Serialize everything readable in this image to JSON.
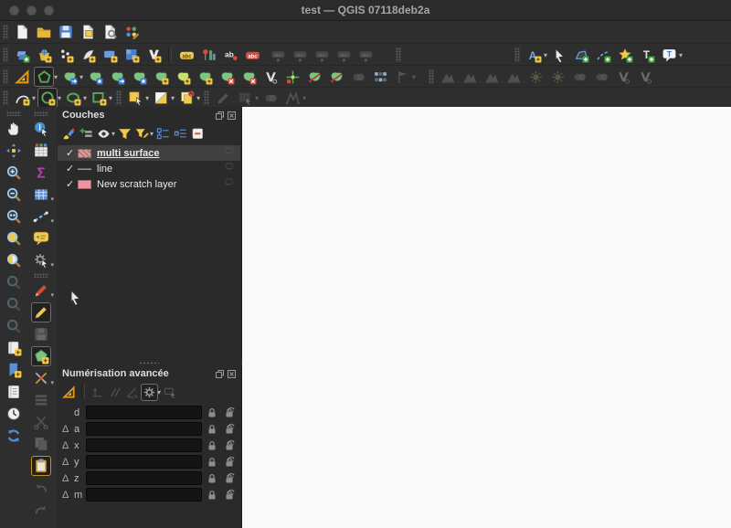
{
  "window": {
    "title": "test — QGIS 07118deb2a"
  },
  "colors": {
    "toolbar_bg": "#2e2e2e",
    "panel_bg": "#2a2a2a",
    "canvas_bg": "#fbfafa",
    "selection_bg": "#404040",
    "accent_blue": "#5b8fd6",
    "accent_yellow": "#f2c94c",
    "accent_green": "#7cc47f",
    "accent_red": "#d84b3a",
    "scratch_pink": "#ef93a1"
  },
  "toolbars": {
    "row1": [
      {
        "t": "h"
      },
      {
        "n": "new-project-icon",
        "k": "page"
      },
      {
        "n": "open-project-icon",
        "k": "folder"
      },
      {
        "n": "save-project-icon",
        "k": "floppy"
      },
      {
        "n": "new-print-layout-icon",
        "k": "layout"
      },
      {
        "n": "layout-manager-icon",
        "k": "wrenchdoc"
      },
      {
        "n": "style-manager-icon",
        "k": "styledots"
      }
    ],
    "row2": [
      {
        "t": "h"
      },
      {
        "n": "data-source-manager-icon",
        "k": "layersplus"
      },
      {
        "n": "new-geopackage-layer-icon",
        "k": "bucket"
      },
      {
        "n": "new-shapefile-layer-icon",
        "k": "dots3"
      },
      {
        "n": "new-spatialite-layer-icon",
        "k": "quill"
      },
      {
        "n": "new-temporary-scratch-layer-icon",
        "k": "bluerect"
      },
      {
        "n": "new-mesh-layer-icon",
        "k": "meshsq"
      },
      {
        "n": "new-virtual-layer-icon",
        "k": "vlayer"
      },
      {
        "t": "s"
      },
      {
        "n": "layer-labeling-icon",
        "k": "tag",
        "c": "#f2c94c"
      },
      {
        "n": "layer-diagram-icon",
        "k": "labelpin"
      },
      {
        "n": "labeling-options-icon",
        "k": "abdot"
      },
      {
        "n": "layer-labeling-rules-icon",
        "k": "tag",
        "c": "#d84b3a"
      },
      {
        "t": "sp",
        "w": 4
      },
      {
        "n": "pin-labels-icon",
        "k": "tagpin",
        "d": 1
      },
      {
        "n": "highlight-pinned-labels-icon",
        "k": "tagpin",
        "d": 1
      },
      {
        "n": "move-label-icon",
        "k": "tagpin",
        "d": 1
      },
      {
        "n": "rotate-label-icon",
        "k": "tagpin",
        "d": 1
      },
      {
        "n": "change-label-icon",
        "k": "tagpin",
        "d": 1
      },
      {
        "t": "sp",
        "w": 18
      },
      {
        "t": "h"
      },
      {
        "t": "sp",
        "w": 118
      },
      {
        "t": "h"
      },
      {
        "n": "annotation-layer-icon",
        "k": "astar",
        "dd": 1
      },
      {
        "n": "select-annotation-icon",
        "k": "cursor"
      },
      {
        "n": "polygon-annotation-icon",
        "k": "polyannot"
      },
      {
        "n": "line-annotation-icon",
        "k": "lineannot"
      },
      {
        "n": "marker-annotation-icon",
        "k": "starannot"
      },
      {
        "n": "text-annotation-icon",
        "k": "tannot"
      },
      {
        "n": "text-balloon-annotation-icon",
        "k": "balloon",
        "dd": 1
      }
    ],
    "row3": [
      {
        "t": "h"
      },
      {
        "n": "advanced-digitizing-icon",
        "k": "setsquare"
      },
      {
        "n": "digitize-with-shape-icon",
        "k": "pentagon",
        "a": 1,
        "dd": 1
      },
      {
        "n": "move-feature-icon",
        "k": "blob",
        "b": "arr",
        "bc": "#3d79d8",
        "dd": 1
      },
      {
        "n": "rotate-feature-icon",
        "k": "blob",
        "b": "dot",
        "bc": "#3d79d8"
      },
      {
        "n": "simplify-feature-icon",
        "k": "blob",
        "b": "arr",
        "bc": "#3d79d8"
      },
      {
        "n": "add-ring-icon",
        "k": "blob",
        "b": "dot",
        "bc": "#4d7fd0"
      },
      {
        "n": "add-part-icon",
        "k": "blob",
        "b": "star",
        "bc": "#f2c94c"
      },
      {
        "n": "fill-ring-icon",
        "k": "blob",
        "c": "#cbe06a",
        "b": "star",
        "bc": "#f2c94c"
      },
      {
        "n": "delete-ring-icon",
        "k": "blob",
        "b": "star",
        "bc": "#f2c94c"
      },
      {
        "n": "delete-part-icon",
        "k": "blob",
        "b": "x",
        "bc": "#d84b3a"
      },
      {
        "n": "offset-curve-icon",
        "k": "blob",
        "b": "x",
        "bc": "#d84b3a"
      },
      {
        "n": "reshape-features-icon",
        "k": "vdot"
      },
      {
        "n": "trim-extend-icon",
        "k": "crosstarget"
      },
      {
        "n": "split-features-icon",
        "k": "split"
      },
      {
        "n": "split-parts-icon",
        "k": "split"
      },
      {
        "n": "merge-features-icon",
        "k": "graydots",
        "d": 1
      },
      {
        "n": "merge-attributes-icon",
        "k": "gridcells"
      },
      {
        "n": "rotate-point-symbols-icon",
        "k": "flag",
        "d": 1,
        "dd": 1
      },
      {
        "t": "sp",
        "w": 10
      },
      {
        "t": "h"
      },
      {
        "n": "edit-mesh-icon",
        "k": "mountain",
        "d": 1
      },
      {
        "n": "transform-mesh-vertices-icon",
        "k": "mountain",
        "d": 1
      },
      {
        "n": "reindex-mesh-icon",
        "k": "mountain",
        "d": 1
      },
      {
        "n": "force-mesh-by-lines-icon",
        "k": "mountain",
        "d": 1
      },
      {
        "n": "mesh-elevation-icon",
        "k": "sunmesh",
        "d": 1
      },
      {
        "n": "mesh-shading-icon",
        "k": "sunmesh",
        "d": 1
      },
      {
        "n": "mesh-selection-icon",
        "k": "graydots",
        "d": 1
      },
      {
        "n": "mesh-selection-polygon-icon",
        "k": "graydots",
        "d": 1
      },
      {
        "n": "mesh-split-icon",
        "k": "vdot",
        "d": 1
      },
      {
        "n": "mesh-refine-icon",
        "k": "vdot",
        "d": 1
      }
    ],
    "row4": [
      {
        "t": "h"
      },
      {
        "n": "circular-string-icon",
        "k": "curveb",
        "dd": 1
      },
      {
        "n": "circle-tool-icon",
        "k": "circleg",
        "a": 1,
        "dd": 1
      },
      {
        "n": "ellipse-tool-icon",
        "k": "ellipseg",
        "dd": 1
      },
      {
        "n": "rectangle-tool-icon",
        "k": "squareg",
        "dd": 1
      },
      {
        "t": "h"
      },
      {
        "n": "select-features-icon",
        "k": "ysqcursor",
        "dd": 1
      },
      {
        "n": "regular-polygon-icon",
        "k": "tribw",
        "dd": 1
      },
      {
        "n": "copy-move-feature-icon",
        "k": "copyred",
        "dd": 1
      },
      {
        "t": "h"
      },
      {
        "n": "gps-edit-icon",
        "k": "pencil",
        "c": "#909090",
        "d": 1
      },
      {
        "n": "select-by-form-icon",
        "k": "mapcursor",
        "d": 1,
        "dd": 1
      },
      {
        "n": "deselect-icon",
        "k": "graydots",
        "d": 1
      },
      {
        "n": "move-vertex-icon",
        "k": "polym",
        "d": 1,
        "dd": 1
      }
    ],
    "left_col1": [
      {
        "t": "hh"
      },
      {
        "n": "pan-map-icon",
        "k": "hand"
      },
      {
        "n": "pan-to-selection-icon",
        "k": "navarrows"
      },
      {
        "n": "zoom-in-icon",
        "k": "mag",
        "g": "+"
      },
      {
        "n": "zoom-out-icon",
        "k": "mag",
        "g": "-"
      },
      {
        "n": "zoom-native-icon",
        "k": "mag",
        "g": "1"
      },
      {
        "n": "zoom-full-icon",
        "k": "magfull"
      },
      {
        "n": "zoom-to-layer-icon",
        "k": "maghalf"
      },
      {
        "n": "zoom-to-selection-icon",
        "k": "mag",
        "d": 1
      },
      {
        "n": "zoom-last-icon",
        "k": "mag",
        "d": 1
      },
      {
        "n": "zoom-next-icon",
        "k": "mag",
        "d": 1
      },
      {
        "n": "new-bookmark-icon",
        "k": "bookstar"
      },
      {
        "n": "show-bookmarks-icon",
        "k": "bookmarkblue"
      },
      {
        "n": "bookmark-manager-icon",
        "k": "bookw"
      },
      {
        "n": "temporal-controller-icon",
        "k": "clock"
      },
      {
        "n": "refresh-map-icon",
        "k": "refresh"
      }
    ],
    "left_col2": [
      {
        "t": "hh"
      },
      {
        "n": "identify-features-icon",
        "k": "identify"
      },
      {
        "n": "attribute-table-icon",
        "k": "tabledots"
      },
      {
        "n": "statistical-summary-icon",
        "k": "sigma"
      },
      {
        "n": "field-calculator-icon",
        "k": "tableblue",
        "dd": 1
      },
      {
        "n": "measure-icon",
        "k": "dashedblue",
        "dd": 1
      },
      {
        "n": "map-tips-icon",
        "k": "bubble"
      },
      {
        "n": "feature-action-icon",
        "k": "gearcursor",
        "dd": 1
      },
      {
        "t": "hh"
      },
      {
        "n": "current-edits-icon",
        "k": "pencil",
        "c": "#d84b3a",
        "dd": 1
      },
      {
        "n": "toggle-editing-icon",
        "k": "pencil",
        "c": "#f2c94c",
        "a": 1
      },
      {
        "n": "save-layer-edits-icon",
        "k": "floppygray",
        "d": 1
      },
      {
        "n": "add-polygon-feature-icon",
        "k": "polystar",
        "a": 1
      },
      {
        "n": "vertex-tool-icon",
        "k": "toolsx",
        "dd": 1
      },
      {
        "n": "modify-attributes-icon",
        "k": "rowsgray",
        "d": 1
      },
      {
        "n": "split-features-left-icon",
        "k": "scissorsgray",
        "d": 1
      },
      {
        "n": "copy-features-icon",
        "k": "pagesgray",
        "d": 1
      },
      {
        "n": "paste-features-icon",
        "k": "clipboard",
        "hl": 1
      },
      {
        "n": "undo-icon",
        "k": "undo",
        "d": 1
      },
      {
        "n": "redo-icon",
        "k": "redo",
        "d": 1
      }
    ]
  },
  "layers_panel": {
    "title": "Couches",
    "toolbar": [
      {
        "n": "open-layer-styling-icon",
        "k": "brushstyle"
      },
      {
        "n": "add-group-icon",
        "k": "plusgroup"
      },
      {
        "n": "manage-map-themes-icon",
        "k": "eye",
        "dd": 1
      },
      {
        "n": "filter-legend-icon",
        "k": "funnel"
      },
      {
        "n": "filter-by-expression-icon",
        "k": "funnelpencil",
        "dd": 1
      },
      {
        "n": "expand-all-icon",
        "k": "expand"
      },
      {
        "n": "collapse-all-icon",
        "k": "collapse"
      },
      {
        "n": "remove-layer-icon",
        "k": "boxminus"
      }
    ],
    "layers": [
      {
        "label": "multi surface",
        "checked": true,
        "selected": true,
        "swatch": "sw-multi",
        "indicator": "memory-layer"
      },
      {
        "label": "line",
        "checked": true,
        "selected": false,
        "swatch": "sw-line",
        "indicator": "memory-layer"
      },
      {
        "label": "New scratch layer",
        "checked": true,
        "selected": false,
        "swatch": "sw-scratch",
        "indicator": "memory-layer"
      }
    ],
    "check_glyph": "✓"
  },
  "digitizing_panel": {
    "title": "Numérisation avancée",
    "toolbar": [
      {
        "n": "enable-advanced-digitizing-icon",
        "k": "setsquare"
      },
      {
        "t": "s"
      },
      {
        "n": "construction-mode-icon",
        "k": "construction",
        "d": 1
      },
      {
        "n": "parallel-mode-icon",
        "k": "parallel",
        "d": 1
      },
      {
        "n": "perpendicular-mode-icon",
        "k": "perp",
        "d": 1
      },
      {
        "n": "settings-gear-icon",
        "k": "gear",
        "a": 1,
        "dd": 1
      },
      {
        "n": "floater-icon",
        "k": "floatercur",
        "d": 1
      }
    ],
    "delta_glyph": "Δ",
    "rows": [
      {
        "delta": false,
        "label": "d",
        "value": ""
      },
      {
        "delta": true,
        "label": "a",
        "value": ""
      },
      {
        "delta": true,
        "label": "x",
        "value": ""
      },
      {
        "delta": true,
        "label": "y",
        "value": ""
      },
      {
        "delta": true,
        "label": "z",
        "value": ""
      },
      {
        "delta": true,
        "label": "m",
        "value": ""
      }
    ]
  }
}
